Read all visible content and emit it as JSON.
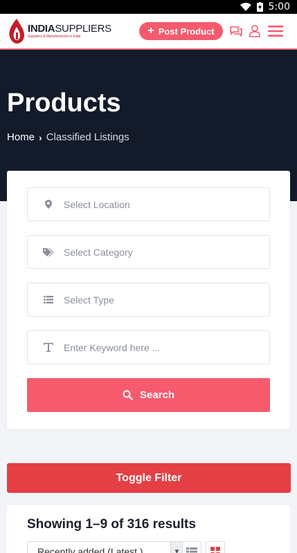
{
  "status_bar": {
    "time": "5:00"
  },
  "header": {
    "logo_bold": "INDIA",
    "logo_light": "SUPPLIERS",
    "logo_tagline": "Suppliers & Manufacturers in India",
    "post_button": "Post Product",
    "icons": [
      "chat-icon",
      "user-icon",
      "menu-icon"
    ],
    "accent": "#f55a6d"
  },
  "hero": {
    "title": "Products",
    "breadcrumb": {
      "home": "Home",
      "separator": "›",
      "current": "Classified Listings"
    },
    "background": "#131a2a"
  },
  "filters": {
    "location_placeholder": "Select Location",
    "category_placeholder": "Select Category",
    "type_placeholder": "Select Type",
    "keyword_placeholder": "Enter Keyword here ...",
    "search_button": "Search"
  },
  "toggle_filter": {
    "label": "Toggle Filter",
    "color": "#e33f45"
  },
  "results": {
    "count_text": "Showing 1–9 of 316 results",
    "sort_selected": "Recently added (Latest )"
  }
}
